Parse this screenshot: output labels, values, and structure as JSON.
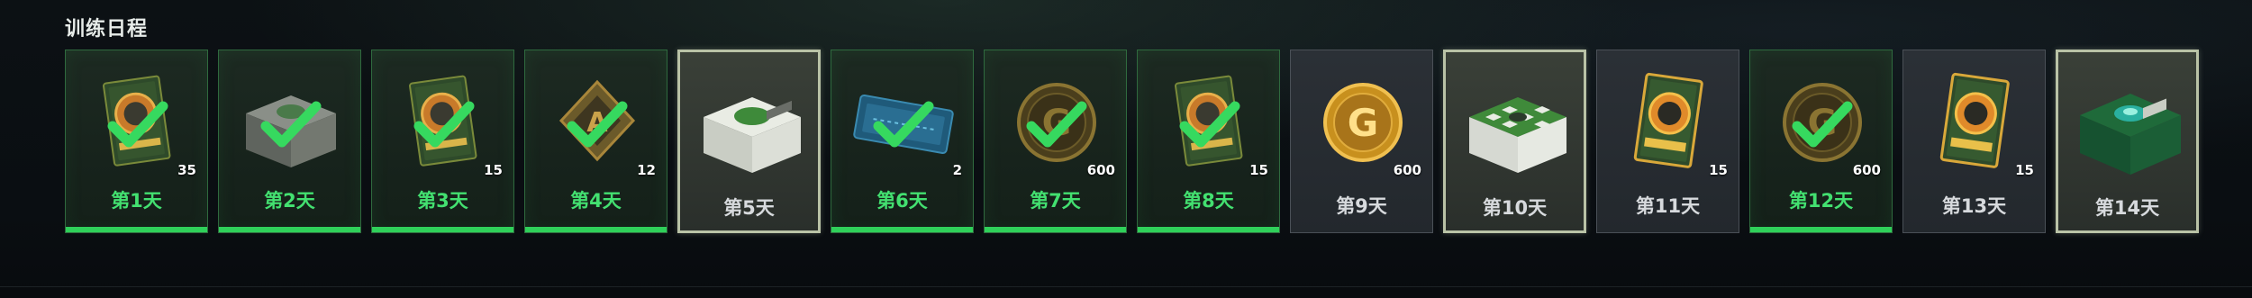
{
  "section": {
    "title": "训练日程"
  },
  "colors": {
    "claimed_border": "#2f6a3e",
    "claimed_label": "#43e070",
    "checkmark": "#36d95f",
    "featured_border": "#b9c2a6"
  },
  "days": [
    {
      "label": "第1天",
      "count": "35",
      "status": "claimed",
      "reward_icon": "blueprint-card-icon"
    },
    {
      "label": "第2天",
      "count": "",
      "status": "claimed",
      "reward_icon": "supply-box-icon"
    },
    {
      "label": "第3天",
      "count": "15",
      "status": "claimed",
      "reward_icon": "blueprint-card-icon"
    },
    {
      "label": "第4天",
      "count": "12",
      "status": "claimed",
      "reward_icon": "diamond-emblem-icon"
    },
    {
      "label": "第5天",
      "count": "",
      "status": "featured",
      "reward_icon": "green-crate-icon"
    },
    {
      "label": "第6天",
      "count": "2",
      "status": "claimed",
      "reward_icon": "ticket-icon"
    },
    {
      "label": "第7天",
      "count": "600",
      "status": "claimed",
      "reward_icon": "coin-icon"
    },
    {
      "label": "第8天",
      "count": "15",
      "status": "claimed",
      "reward_icon": "blueprint-card-icon"
    },
    {
      "label": "第9天",
      "count": "600",
      "status": "pending",
      "reward_icon": "gold-coin-icon"
    },
    {
      "label": "第10天",
      "count": "",
      "status": "featured",
      "reward_icon": "checker-crate-icon"
    },
    {
      "label": "第11天",
      "count": "15",
      "status": "pending",
      "reward_icon": "blueprint-card-icon"
    },
    {
      "label": "第12天",
      "count": "600",
      "status": "claimed",
      "reward_icon": "coin-icon"
    },
    {
      "label": "第13天",
      "count": "15",
      "status": "pending",
      "reward_icon": "blueprint-card-icon"
    },
    {
      "label": "第14天",
      "count": "",
      "status": "featured",
      "reward_icon": "emerald-crate-icon"
    }
  ]
}
